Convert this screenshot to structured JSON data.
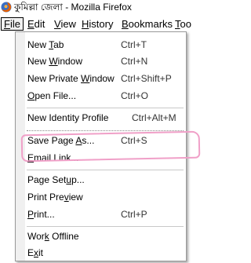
{
  "window": {
    "title": "কুমিল্লা জেলা - Mozilla Firefox",
    "app_icon": "firefox-icon"
  },
  "menubar": {
    "items": [
      {
        "label": "File",
        "mnemonic": "F",
        "rest": "ile",
        "active": true
      },
      {
        "label": "Edit",
        "mnemonic": "E",
        "rest": "dit"
      },
      {
        "label": "View",
        "mnemonic": "V",
        "rest": "iew"
      },
      {
        "label": "History",
        "mnemonic": "H",
        "rest": "istory"
      },
      {
        "label": "Bookmarks",
        "mnemonic": "B",
        "rest": "ookmarks"
      },
      {
        "label": "Too",
        "mnemonic": "T",
        "rest": "oo"
      }
    ]
  },
  "file_menu": {
    "items": [
      {
        "label": "New Tab",
        "pre": "New ",
        "mn": "T",
        "post": "ab",
        "shortcut": "Ctrl+T"
      },
      {
        "label": "New Window",
        "pre": "New ",
        "mn": "W",
        "post": "indow",
        "shortcut": "Ctrl+N"
      },
      {
        "label": "New Private Window",
        "pre": "New Private ",
        "mn": "W",
        "post": "indow",
        "shortcut": "Ctrl+Shift+P"
      },
      {
        "label": "Open File...",
        "pre": "",
        "mn": "O",
        "post": "pen File...",
        "shortcut": "Ctrl+O"
      },
      {
        "label": "New Identity Profile",
        "pre": "New Identity Profile",
        "mn": "",
        "post": "",
        "shortcut": "Ctrl+Alt+M"
      },
      {
        "label": "Save Page As...",
        "pre": "Save Page ",
        "mn": "A",
        "post": "s...",
        "shortcut": "Ctrl+S"
      },
      {
        "label": "Email Link...",
        "pre": "",
        "mn": "E",
        "post": "mail Link...",
        "shortcut": ""
      },
      {
        "label": "Page Setup...",
        "pre": "Page Set",
        "mn": "u",
        "post": "p...",
        "shortcut": ""
      },
      {
        "label": "Print Preview",
        "pre": "Print Pre",
        "mn": "v",
        "post": "iew",
        "shortcut": ""
      },
      {
        "label": "Print...",
        "pre": "",
        "mn": "P",
        "post": "rint...",
        "shortcut": "Ctrl+P"
      },
      {
        "label": "Work Offline",
        "pre": "Wor",
        "mn": "k",
        "post": " Offline",
        "shortcut": ""
      },
      {
        "label": "Exit",
        "pre": "E",
        "mn": "x",
        "post": "it",
        "shortcut": ""
      }
    ]
  },
  "annotation": {
    "highlight_color": "#f0a0c8",
    "highlighted_item": "New Identity Profile"
  }
}
